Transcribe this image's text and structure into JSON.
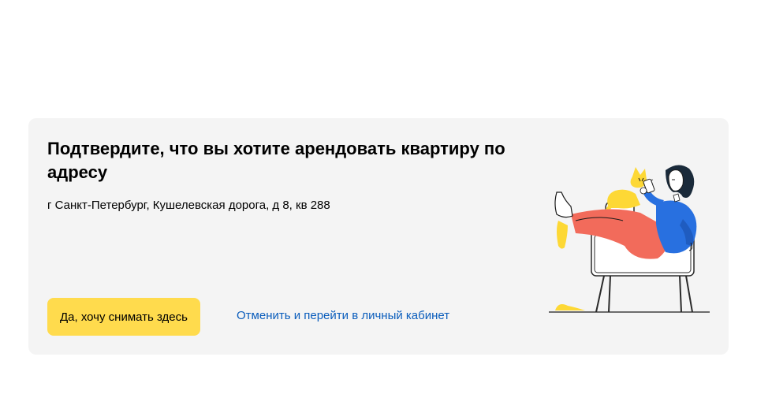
{
  "dialog": {
    "title": "Подтвердите, что вы хотите арендовать квартиру по адресу",
    "address": "г Санкт-Петербург, Кушелевская дорога, д 8, кв 288",
    "confirm_label": "Да, хочу снимать здесь",
    "cancel_label": "Отменить и перейти в личный кабинет",
    "illustration_icon": "woman-in-armchair-with-cat-illustration"
  },
  "colors": {
    "card_background": "#f4f4f4",
    "confirm_button": "#ffdb4d",
    "link": "#0a5dbc",
    "illustration_yellow": "#fdd835",
    "illustration_blue": "#2870e0",
    "illustration_coral": "#f26b5b"
  }
}
